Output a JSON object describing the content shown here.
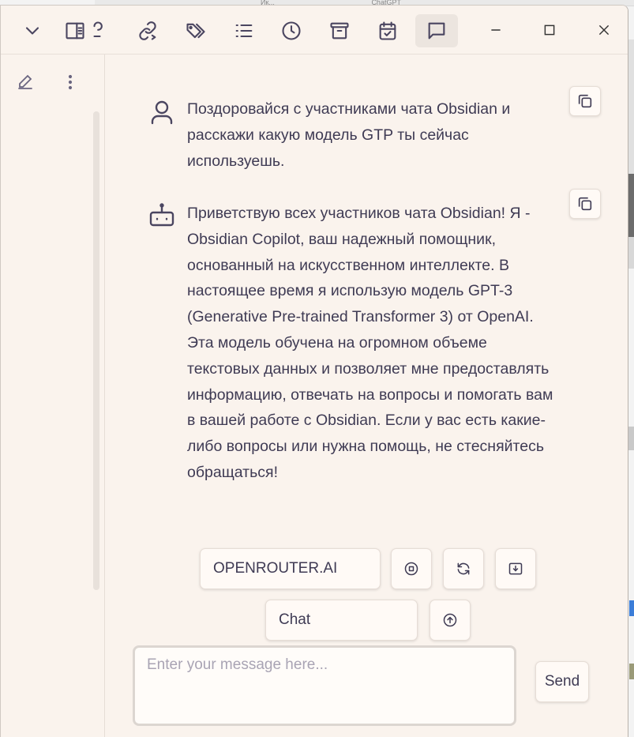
{
  "background_window": {
    "tab_texts": [
      "Ик...",
      "ChatGPT"
    ]
  },
  "toolbar": {
    "icons": [
      "chevron-down-icon",
      "sidebar-toggle-icon",
      "partial-icon",
      "link-icon",
      "tags-icon",
      "list-icon",
      "clock-icon",
      "archive-icon",
      "calendar-check-icon",
      "chat-icon"
    ],
    "active": "chat-icon"
  },
  "window_controls": [
    "minimize-icon",
    "maximize-icon",
    "close-icon"
  ],
  "sidebar": {
    "icons": [
      "edit-icon",
      "more-vertical-icon"
    ]
  },
  "messages": [
    {
      "role": "user",
      "avatar_icon": "user-icon",
      "lines": [
        "Поздоровайся с участниками чата Obsidian и",
        "расскажи какую модель GTP ты сейчас",
        "используешь."
      ]
    },
    {
      "role": "assistant",
      "avatar_icon": "bot-icon",
      "lines": [
        "Приветствую всех участников чата Obsidian! Я -",
        "Obsidian Copilot, ваш надежный помощник,",
        "основанный на искусственном интеллекте. В",
        "настоящее время я использую модель GPT-3",
        "(Generative Pre-trained Transformer 3) от OpenAI.",
        "Эта модель обучена на огромном объеме",
        "текстовых данных и позволяет мне предоставлять",
        "информацию, отвечать на вопросы и помогать вам",
        "в вашей работе с Obsidian. Если у вас есть какие-",
        "либо вопросы или нужна помощь, не стесняйтесь",
        "обращаться!"
      ]
    }
  ],
  "controls": {
    "model_select": "OPENROUTER.AI",
    "mode_select": "Chat",
    "icons": [
      "stop-icon",
      "refresh-icon",
      "download-icon",
      "upload-icon"
    ]
  },
  "composer": {
    "placeholder": "Enter your message here...",
    "value": "",
    "send_label": "Send"
  },
  "colors": {
    "background": "#faf3ed",
    "text": "#3f3b54",
    "button_bg": "#fffaf6"
  }
}
